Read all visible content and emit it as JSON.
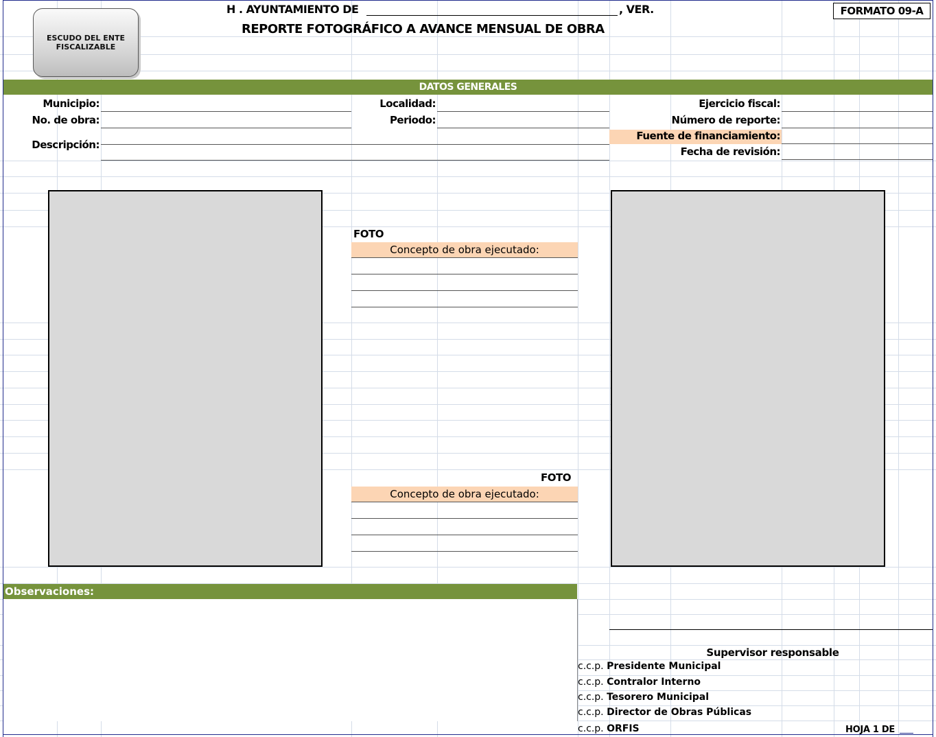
{
  "header": {
    "municipality_prefix": "H . AYUNTAMIENTO DE",
    "municipality_suffix": ", VER.",
    "title": "REPORTE FOTOGRÁFICO A AVANCE MENSUAL DE OBRA",
    "formato": "FORMATO 09-A",
    "escudo_line1": "ESCUDO DEL ENTE",
    "escudo_line2": "FISCALIZABLE"
  },
  "general": {
    "section_title": "DATOS GENERALES",
    "municipio_label": "Municipio:",
    "no_obra_label": "No. de obra:",
    "descripcion_label": "Descripción:",
    "localidad_label": "Localidad:",
    "periodo_label": "Periodo:",
    "ejercicio_label": "Ejercicio fiscal:",
    "numero_reporte_label": "Número de reporte:",
    "fuente_label": "Fuente de financiamiento:",
    "fecha_revision_label": "Fecha de revisión:"
  },
  "photos": {
    "foto_label_1": "FOTO",
    "concepto_label_1": "Concepto de obra ejecutado:",
    "foto_label_2": "FOTO",
    "concepto_label_2": "Concepto de obra ejecutado:"
  },
  "observaciones": {
    "label": "Observaciones:"
  },
  "signature": {
    "supervisor_label": "Supervisor responsable",
    "ccp_prefix": "c.c.p.",
    "ccp": [
      "Presidente Municipal",
      "Contralor Interno",
      "Tesorero Municipal",
      "Director de Obras Públicas",
      "ORFIS"
    ]
  },
  "footer": {
    "hoja": "HOJA 1 DE"
  },
  "colors": {
    "green_bar": "#76933c",
    "salmon": "#fcd5b4",
    "photo_gray": "#d9d9d9"
  }
}
